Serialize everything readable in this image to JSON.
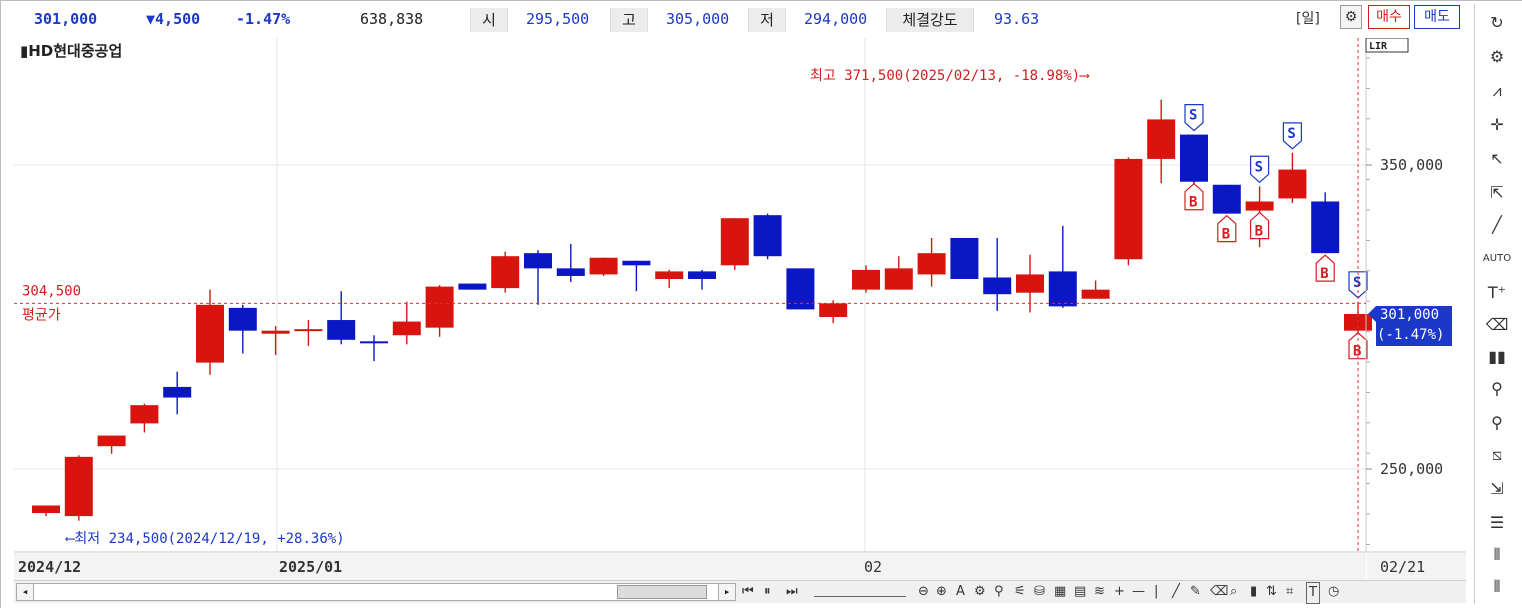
{
  "quote": {
    "price": "301,000",
    "change": "▼4,500",
    "change_pct": "-1.47%",
    "volume": "638,838",
    "open_label": "시",
    "open": "295,500",
    "high_label": "고",
    "high": "305,000",
    "low_label": "저",
    "low": "294,000",
    "strength_label": "체결강도",
    "strength": "93.63"
  },
  "toolbar": {
    "period": "[일]",
    "buy_label": "매수",
    "sell_label": "매도",
    "lr_label": "LIR"
  },
  "chart_title": "▮HD현대중공업",
  "annotations": {
    "max": "최고 371,500(2025/02/13, -18.98%)⟶",
    "min": "⟵최저 234,500(2024/12/19, +28.36%)",
    "avg_value": "304,500",
    "avg_label": "평균가",
    "current_price": "301,000",
    "current_pct": "(-1.47%)",
    "buy_marker": "B",
    "sell_marker": "S"
  },
  "chart_data": {
    "type": "candlestick",
    "title": "HD현대중공업",
    "x_tick_labels": [
      "2024/12",
      "2025/01",
      "02",
      "02/21"
    ],
    "y_tick_labels": [
      "350,000",
      "250,000"
    ],
    "ylim": [
      229000,
      378000
    ],
    "up_color": "#d9140e",
    "down_color": "#0b16c4",
    "reference_line": 304500,
    "candles": [
      {
        "o": 235500,
        "c": 238000,
        "h": 237500,
        "l": 234500
      },
      {
        "o": 234500,
        "c": 254000,
        "h": 254500,
        "l": 233000
      },
      {
        "o": 257500,
        "c": 261000,
        "h": 260500,
        "l": 255000
      },
      {
        "o": 265000,
        "c": 271000,
        "h": 271500,
        "l": 262000
      },
      {
        "o": 277000,
        "c": 273500,
        "h": 282000,
        "l": 268000
      },
      {
        "o": 285000,
        "c": 304000,
        "h": 309000,
        "l": 281000
      },
      {
        "o": 303000,
        "c": 295500,
        "h": 304000,
        "l": 288000
      },
      {
        "o": 294500,
        "c": 295500,
        "h": 297000,
        "l": 287500
      },
      {
        "o": 295500,
        "c": 296000,
        "h": 299000,
        "l": 290500
      },
      {
        "o": 299000,
        "c": 292500,
        "h": 308500,
        "l": 291000
      },
      {
        "o": 292000,
        "c": 291500,
        "h": 294000,
        "l": 285500
      },
      {
        "o": 294000,
        "c": 298500,
        "h": 305000,
        "l": 291000
      },
      {
        "o": 296500,
        "c": 310000,
        "h": 310500,
        "l": 293500
      },
      {
        "o": 311000,
        "c": 309000,
        "h": 311000,
        "l": 309000
      },
      {
        "o": 309500,
        "c": 320000,
        "h": 321500,
        "l": 308000
      },
      {
        "o": 321000,
        "c": 316000,
        "h": 322000,
        "l": 304000
      },
      {
        "o": 316000,
        "c": 313500,
        "h": 324000,
        "l": 311500
      },
      {
        "o": 314000,
        "c": 319500,
        "h": 319500,
        "l": 313500
      },
      {
        "o": 318500,
        "c": 317000,
        "h": 318500,
        "l": 308500
      },
      {
        "o": 312500,
        "c": 315000,
        "h": 315500,
        "l": 309500
      },
      {
        "o": 315000,
        "c": 312500,
        "h": 315500,
        "l": 309000
      },
      {
        "o": 317000,
        "c": 332500,
        "h": 332500,
        "l": 315500
      },
      {
        "o": 333500,
        "c": 320000,
        "h": 334000,
        "l": 319000
      },
      {
        "o": 316000,
        "c": 302500,
        "h": 316000,
        "l": 302500
      },
      {
        "o": 300000,
        "c": 304500,
        "h": 305500,
        "l": 298000
      },
      {
        "o": 309000,
        "c": 315500,
        "h": 317000,
        "l": 308000
      },
      {
        "o": 309000,
        "c": 316000,
        "h": 320000,
        "l": 309000
      },
      {
        "o": 314000,
        "c": 321000,
        "h": 326000,
        "l": 310000
      },
      {
        "o": 326000,
        "c": 312500,
        "h": 326000,
        "l": 312500
      },
      {
        "o": 313000,
        "c": 307500,
        "h": 326000,
        "l": 302000
      },
      {
        "o": 308000,
        "c": 314000,
        "h": 320500,
        "l": 301500
      },
      {
        "o": 315000,
        "c": 303500,
        "h": 330000,
        "l": 303000
      },
      {
        "o": 306000,
        "c": 309000,
        "h": 312000,
        "l": 306000
      },
      {
        "o": 319000,
        "c": 352000,
        "h": 352500,
        "l": 317000
      },
      {
        "o": 352000,
        "c": 365000,
        "h": 371500,
        "l": 344000
      },
      {
        "o": 360000,
        "c": 344500,
        "h": 360000,
        "l": 343500
      },
      {
        "o": 343500,
        "c": 334000,
        "h": 343500,
        "l": 334000
      },
      {
        "o": 335000,
        "c": 338000,
        "h": 343000,
        "l": 323000
      },
      {
        "o": 339000,
        "c": 348500,
        "h": 354000,
        "l": 337500
      },
      {
        "o": 338000,
        "c": 321000,
        "h": 341000,
        "l": 321000
      },
      {
        "o": 295500,
        "c": 301000,
        "h": 305000,
        "l": 294000
      }
    ],
    "trade_markers": [
      {
        "type": "S",
        "candle": 35
      },
      {
        "type": "B",
        "candle": 35
      },
      {
        "type": "S",
        "candle": 37
      },
      {
        "type": "B",
        "candle": 37
      },
      {
        "type": "B",
        "candle": 36
      },
      {
        "type": "S",
        "candle": 38
      },
      {
        "type": "S",
        "candle": 40
      },
      {
        "type": "B",
        "candle": 39
      },
      {
        "type": "B",
        "candle": 40
      }
    ]
  },
  "bottom_toolbar": {
    "scroll_left": "◂",
    "scroll_right": "▸"
  }
}
